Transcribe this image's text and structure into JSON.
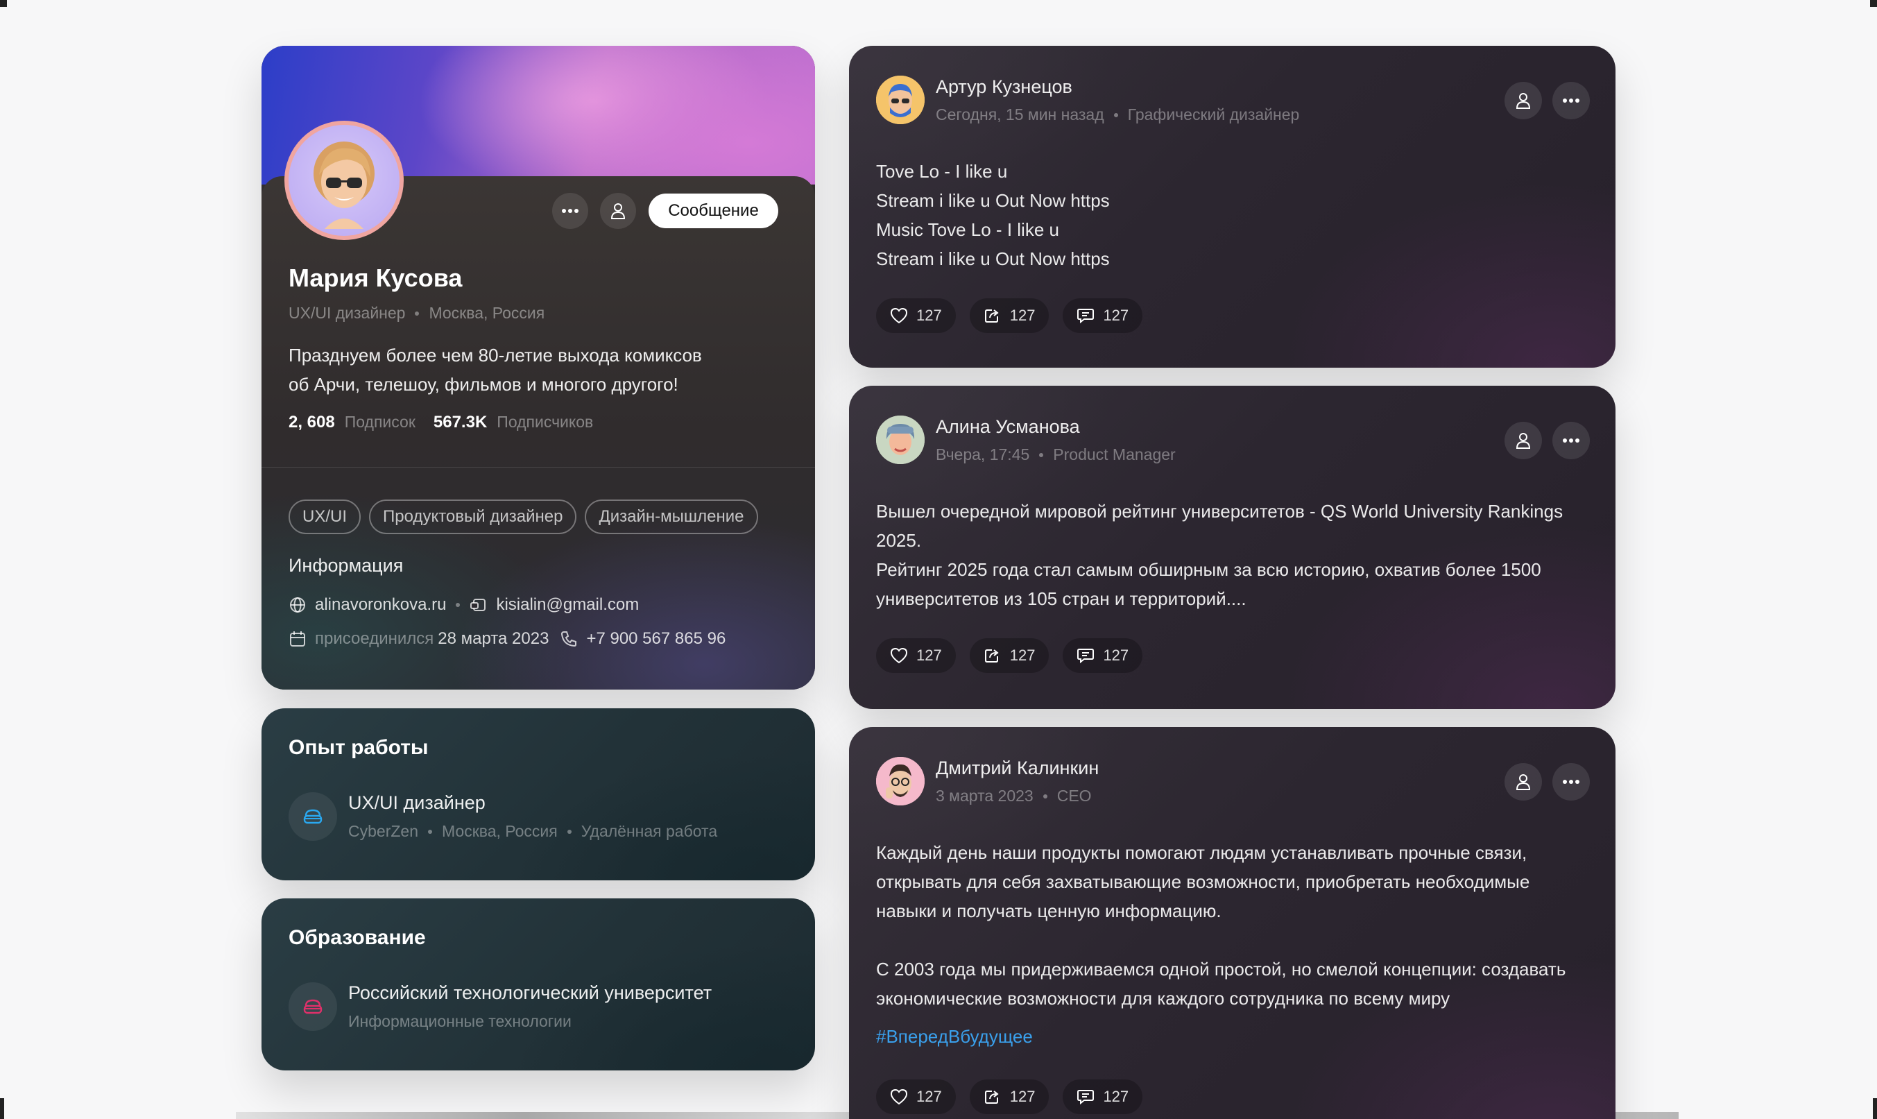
{
  "profile": {
    "name": "Мария Кусова",
    "role": "UX/UI дизайнер",
    "location": "Москва, Россия",
    "message_button": "Сообщение",
    "bio_lines": [
      "Празднуем более чем 80-летие выхода комиксов",
      "об Арчи, телешоу, фильмов и многого другого!"
    ],
    "following_count": "2, 608",
    "following_label": "Подписок",
    "followers_count": "567.3K",
    "followers_label": "Подписчиков",
    "tags": [
      "UX/UI",
      "Продуктовый дизайнер",
      "Дизайн-мышление"
    ],
    "info_title": "Информация",
    "website": "alinavoronkova.ru",
    "email": "kisialin@gmail.com",
    "joined_label": "присоединился",
    "joined_date": "28 марта 2023",
    "phone": "+7 900 567 865 96",
    "colors": {
      "cover_start": "#2c3ec8",
      "cover_end": "#c070d0",
      "avatar_ring": "#f0a5a0"
    }
  },
  "experience": {
    "title": "Опыт работы",
    "position": "UX/UI дизайнер",
    "company": "CyberZen",
    "location": "Москва, Россия",
    "mode": "Удалённая работа",
    "icon": "briefcase-icon",
    "icon_color": "#2aa8f0"
  },
  "education": {
    "title": "Образование",
    "school": "Российский технологический университет",
    "field": "Информационные технологии",
    "icon": "briefcase-icon",
    "icon_color": "#e0306a"
  },
  "posts": [
    {
      "author": "Артур Кузнецов",
      "time": "Сегодня, 15 мин назад",
      "role": "Графический дизайнер",
      "lines": [
        "Tove Lo - I like u",
        "Stream i like u Out Now https",
        "Music Tove Lo - I like u",
        "Stream i like u Out Now https"
      ],
      "likes": "127",
      "shares": "127",
      "comments": "127"
    },
    {
      "author": "Алина Усманова",
      "time": "Вчера, 17:45",
      "role": "Product Manager",
      "lines": [
        "Вышел очередной мировой рейтинг университетов - QS World University Rankings",
        "2025.",
        "Рейтинг 2025 года стал самым обширным за всю историю, охватив более 1500",
        "университетов из 105 стран и территорий...."
      ],
      "likes": "127",
      "shares": "127",
      "comments": "127"
    },
    {
      "author": "Дмитрий Калинкин",
      "time": "3 марта 2023",
      "role": "CEO",
      "lines": [
        "Каждый день наши продукты помогают людям устанавливать прочные связи,",
        "открывать для себя захватывающие возможности, приобретать необходимые",
        "навыки и получать ценную информацию.",
        "",
        "С 2003 года мы придерживаемся одной простой, но смелой концепции: создавать",
        "экономические возможности для каждого сотрудника по всему миру"
      ],
      "hashtag": "#ВпередВбудущее",
      "likes": "127",
      "shares": "127",
      "comments": "127"
    }
  ]
}
